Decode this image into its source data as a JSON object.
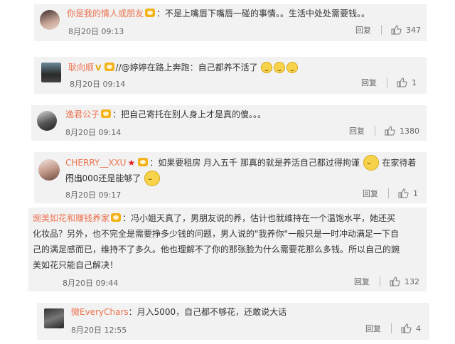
{
  "comments": [
    {
      "user": "你是我的情人或朋友",
      "text": "：不是上嘴唇下嘴唇一碰的事情。。生活中处处需要钱。。",
      "time": "8月20日 09:13",
      "reply": "回复",
      "likes": "347"
    },
    {
      "user": "耿向顺",
      "text": "//@婷婷在路上奔跑：自己都养不活了",
      "time": "8月20日 09:14",
      "reply": "回复",
      "likes": "1"
    },
    {
      "user": "逸君公子",
      "text": "：把自己寄托在别人身上才是真的傻。。。",
      "time": "8月20日 09:14",
      "reply": "回复",
      "likes": "1380"
    },
    {
      "user": "CHERRY__XXU",
      "text_line1": "：如果要租房 月入五千 那真的就是养活自己都过得拘谨",
      "text_line1b": "在家待着不出",
      "text_line2": "门 5000还是能够了",
      "time": "8月20日 09:17",
      "reply": "回复",
      "likes": "1"
    },
    {
      "user": "豌美如花和赚钱养家",
      "text_line1": "：冯小姐天真了，男朋友说的养，估计也就维持在一个温饱水平，她还买",
      "text_line2": "化妆品？另外，也不完全是需要挣多少钱的问题，男人说的\"我养你\"一般只是一时冲动满足一下自",
      "text_line3": "己的满足感而已，维持不了多久。他也理解不了你的那张脸为什么需要花那么多钱。所以自己的豌",
      "text_line4": "美如花只能自己解决！",
      "time": "8月20日 09:44",
      "reply": "回复",
      "likes": "132"
    },
    {
      "user": "微EveryChars",
      "text": "：月入5000，自己都不够花，还敢说大话",
      "time": "8月20日 12:55",
      "reply": "回复",
      "likes": "4"
    }
  ]
}
